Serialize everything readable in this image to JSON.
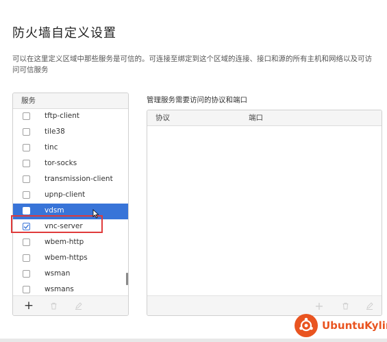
{
  "page": {
    "title": "防火墙自定义设置",
    "description": "可以在这里定义区域中那些服务是可信的。可连接至绑定到这个区域的连接、接口和源的所有主机和网络以及可访问可信服务"
  },
  "services": {
    "header": "服务",
    "items": [
      {
        "name": "tftp-client",
        "checked": false,
        "selected": false
      },
      {
        "name": "tile38",
        "checked": false,
        "selected": false
      },
      {
        "name": "tinc",
        "checked": false,
        "selected": false
      },
      {
        "name": "tor-socks",
        "checked": false,
        "selected": false
      },
      {
        "name": "transmission-client",
        "checked": false,
        "selected": false
      },
      {
        "name": "upnp-client",
        "checked": false,
        "selected": false
      },
      {
        "name": "vdsm",
        "checked": false,
        "selected": true
      },
      {
        "name": "vnc-server",
        "checked": true,
        "selected": false
      },
      {
        "name": "wbem-http",
        "checked": false,
        "selected": false
      },
      {
        "name": "wbem-https",
        "checked": false,
        "selected": false
      },
      {
        "name": "wsman",
        "checked": false,
        "selected": false
      },
      {
        "name": "wsmans",
        "checked": false,
        "selected": false
      }
    ],
    "toolbar": {
      "add": "+",
      "delete": "🗑",
      "edit": "✎"
    }
  },
  "ports": {
    "label": "管理服务需要访问的协议和端口",
    "columns": [
      "协议",
      "端口"
    ],
    "toolbar": {
      "add": "+",
      "delete": "🗑",
      "edit": "✎"
    }
  },
  "watermark": {
    "text": "UbuntuKylin",
    "color": "#e95420"
  },
  "colors": {
    "accent": "#3874d8",
    "highlight": "#e03a3a"
  }
}
